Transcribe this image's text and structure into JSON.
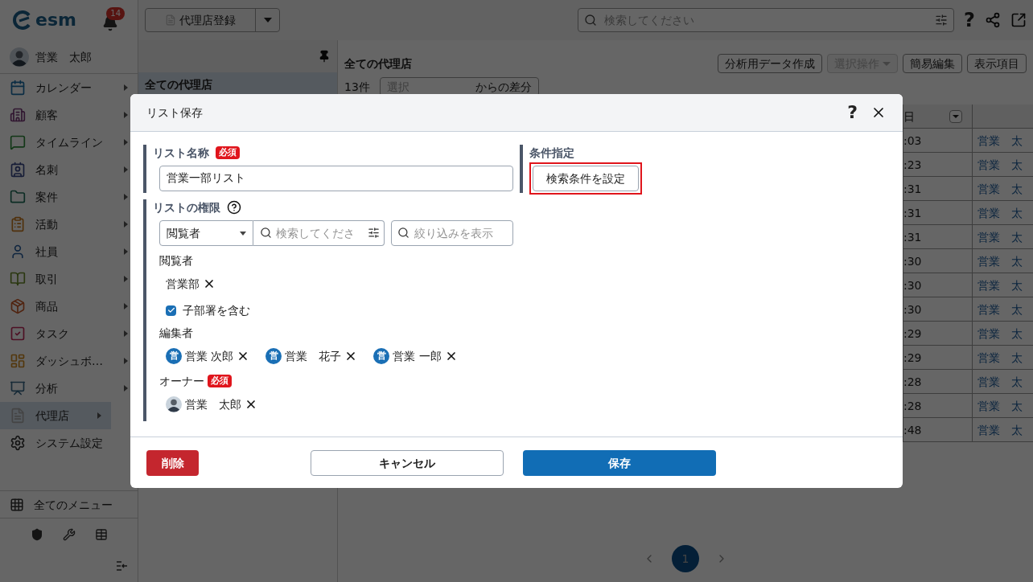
{
  "app": {
    "logo": "esm",
    "notifications": "14",
    "user": {
      "name": "営業　太郎"
    }
  },
  "sidebar": {
    "items": [
      {
        "label": "カレンダー",
        "submenu": true,
        "selected": false
      },
      {
        "label": "顧客",
        "submenu": true,
        "selected": false
      },
      {
        "label": "タイムライン",
        "submenu": true,
        "selected": false
      },
      {
        "label": "名刺",
        "submenu": true,
        "selected": false
      },
      {
        "label": "案件",
        "submenu": true,
        "selected": false
      },
      {
        "label": "活動",
        "submenu": true,
        "selected": false
      },
      {
        "label": "社員",
        "submenu": true,
        "selected": false
      },
      {
        "label": "取引",
        "submenu": true,
        "selected": false
      },
      {
        "label": "商品",
        "submenu": true,
        "selected": false
      },
      {
        "label": "タスク",
        "submenu": true,
        "selected": false
      },
      {
        "label": "ダッシュボ…",
        "submenu": true,
        "selected": false
      },
      {
        "label": "分析",
        "submenu": true,
        "selected": false
      },
      {
        "label": "代理店",
        "submenu": true,
        "selected": true
      },
      {
        "label": "システム設定",
        "submenu": false,
        "selected": false
      }
    ],
    "all_menu": "全てのメニュー"
  },
  "toolbar": {
    "register_button": "代理店登録",
    "search": {
      "placeholder": "検索してください"
    },
    "help": "?"
  },
  "list_panel": {
    "items": [
      {
        "label": "全ての代理店",
        "selected": true
      }
    ]
  },
  "content": {
    "title": "全ての代理店",
    "buttons": [
      {
        "label": "分析用データ作成",
        "disabled": false,
        "kind": "plain"
      },
      {
        "label": "選択操作",
        "disabled": true,
        "kind": "menu"
      },
      {
        "label": "簡易編集",
        "disabled": false,
        "kind": "plain"
      },
      {
        "label": "表示項目",
        "disabled": false,
        "kind": "plain"
      }
    ],
    "count": "13件",
    "diff_select": {
      "placeholder": "選択",
      "suffix": "からの差分"
    }
  },
  "table": {
    "columns": [
      "日"
    ],
    "rows": [
      {
        "column_1": ":03",
        "column_2": "営業　太"
      },
      {
        "column_1": ":23",
        "column_2": "営業　太"
      },
      {
        "column_1": ":31",
        "column_2": "営業　太"
      },
      {
        "column_1": ":31",
        "column_2": "営業　太"
      },
      {
        "column_1": ":31",
        "column_2": "営業　太"
      },
      {
        "column_1": ":30",
        "column_2": "営業　太"
      },
      {
        "column_1": ":30",
        "column_2": "営業　太"
      },
      {
        "column_1": ":30",
        "column_2": "営業　太"
      },
      {
        "column_1": ":29",
        "column_2": "営業　太"
      },
      {
        "column_1": ":29",
        "column_2": "営業　太"
      },
      {
        "column_1": ":28",
        "column_2": "営業　太"
      },
      {
        "column_1": ":28",
        "column_2": "営業　太"
      },
      {
        "column_1": ":48",
        "column_2": "営業　太"
      }
    ]
  },
  "pagination": {
    "pages": [
      {
        "label": "1",
        "selected": true
      }
    ]
  },
  "dialog": {
    "title": "リスト保存",
    "help": "?",
    "name_section": {
      "label": "リスト名称",
      "required": "必須",
      "value": "営業一部リスト"
    },
    "condition_section": {
      "label": "条件指定",
      "button": "検索条件を設定",
      "highlighted": true
    },
    "permission_section": {
      "label": "リストの権限",
      "role_select": "閲覧者",
      "search": {
        "placeholder": "検索してくださ"
      },
      "filter": {
        "placeholder": "絞り込みを表示"
      },
      "groups": [
        {
          "label": "閲覧者",
          "members": [
            {
              "kind": "department",
              "name": "営業部"
            }
          ],
          "option": {
            "label": "子部署を含む",
            "checked": true
          }
        },
        {
          "label": "編集者",
          "members": [
            {
              "kind": "user",
              "initial": "営",
              "name": "営業 次郎"
            },
            {
              "kind": "user",
              "initial": "営",
              "name": "営業　花子"
            },
            {
              "kind": "user",
              "initial": "営",
              "name": "営業 一郎"
            }
          ]
        },
        {
          "label": "オーナー",
          "required": "必須",
          "members": [
            {
              "kind": "photo",
              "name": "営業　太郎"
            }
          ]
        }
      ]
    },
    "buttons": {
      "delete": "削除",
      "cancel": "キャンセル",
      "save": "保存"
    }
  }
}
